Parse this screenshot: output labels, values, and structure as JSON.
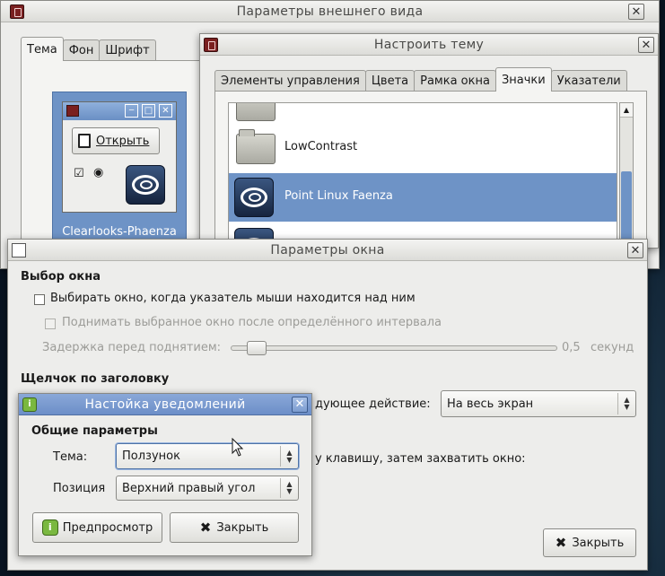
{
  "appearance": {
    "title": "Параметры внешнего вида",
    "tabs": [
      "Тема",
      "Фон",
      "Шрифт"
    ],
    "preview": {
      "open_label": "Открыть",
      "theme_name": "Clearlooks-Phaenza"
    }
  },
  "customize": {
    "title": "Настроить тему",
    "tabs": [
      "Элементы управления",
      "Цвета",
      "Рамка окна",
      "Значки",
      "Указатели"
    ],
    "icon_themes": [
      {
        "name": "LowContrast",
        "selected": false
      },
      {
        "name": "Point Linux Faenza",
        "selected": true
      }
    ]
  },
  "window_params": {
    "title": "Параметры окна",
    "selection_heading": "Выбор окна",
    "select_on_hover": "Выбирать окно, когда указатель мыши находится над ним",
    "raise_after_interval": "Поднимать выбранное окно после определённого интервала",
    "delay_label": "Задержка перед поднятием:",
    "delay_value": "0,5",
    "delay_unit": "секунд",
    "delay_fraction": 0.05,
    "titlebar_heading": "Щелчок по заголовку",
    "double_click_partial": "дующее действие:",
    "double_click_value": "На весь экран",
    "move_partial": "у клавишу, затем захватить окно:",
    "close_label": "Закрыть"
  },
  "notify": {
    "title": "Настойка уведомлений",
    "section": "Общие параметры",
    "theme_label": "Тема:",
    "theme_value": "Ползунок",
    "position_label": "Позиция",
    "position_value": "Верхний правый угол",
    "preview_label": "Предпросмотр",
    "close_label": "Закрыть"
  },
  "colors": {
    "selection": "#6e93c6",
    "title_accent": "#7896c8"
  }
}
